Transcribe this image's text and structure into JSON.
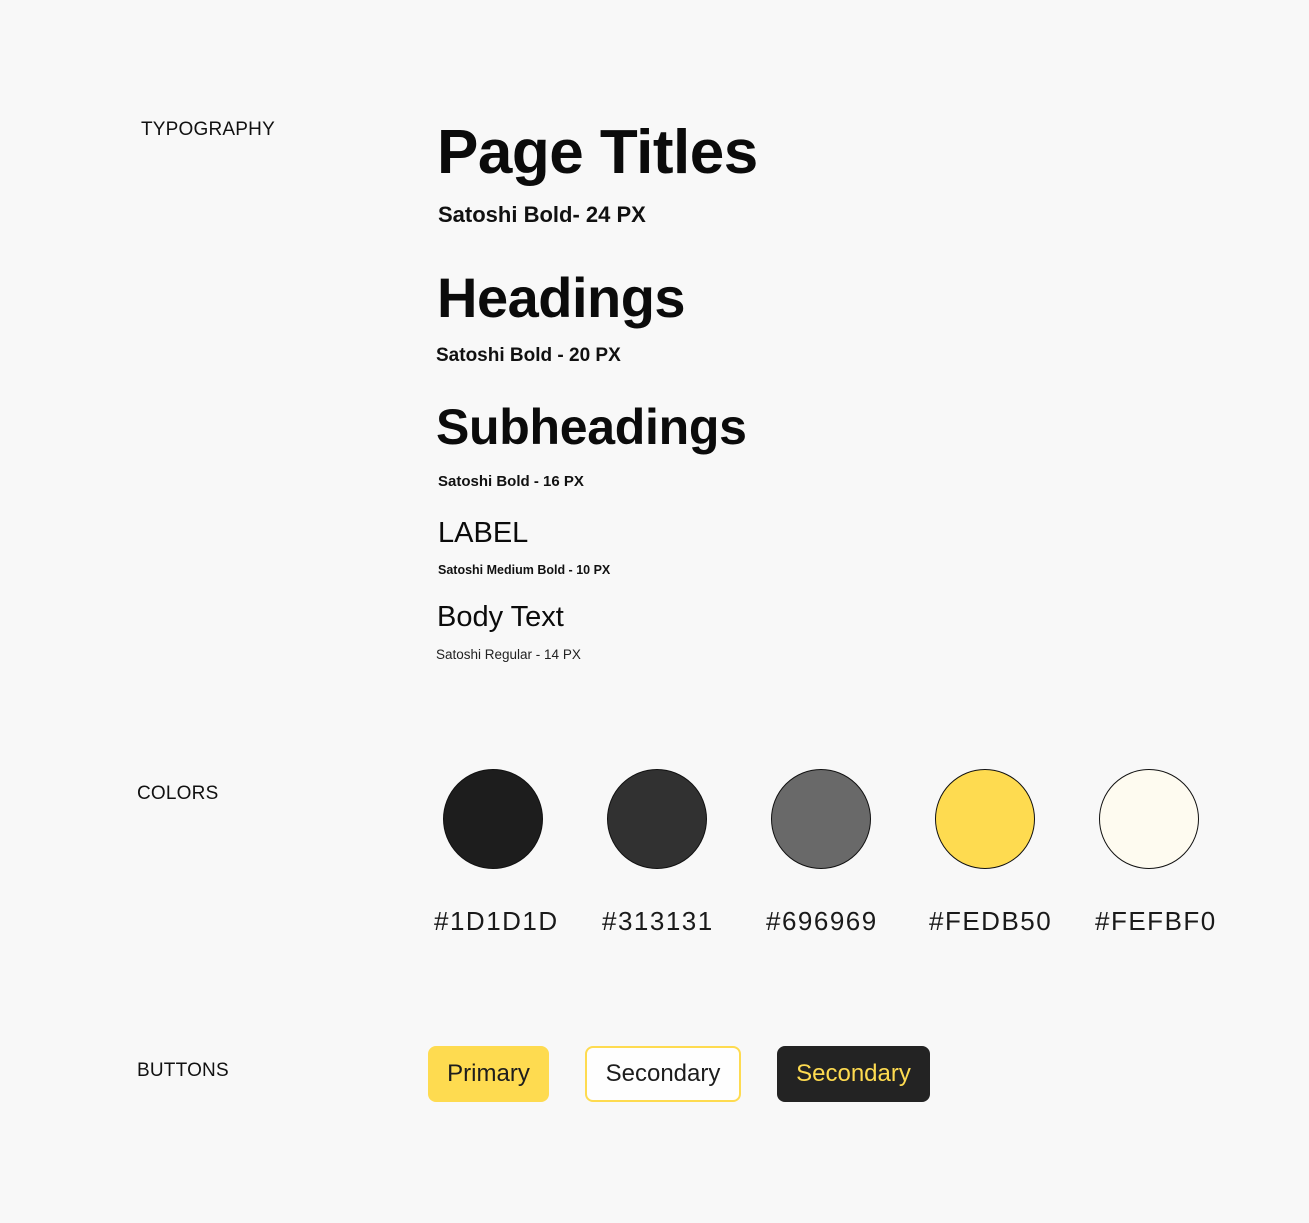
{
  "sections": {
    "typography": "TYPOGRAPHY",
    "colors": "COLORS",
    "buttons": "BUTTONS"
  },
  "typography": {
    "page_title": {
      "sample": "Page Titles",
      "desc": "Satoshi Bold- 24 PX"
    },
    "headings": {
      "sample": "Headings",
      "desc": "Satoshi Bold - 20 PX"
    },
    "subheadings": {
      "sample": "Subheadings",
      "desc": "Satoshi Bold - 16 PX"
    },
    "label": {
      "sample": "LABEL",
      "desc": "Satoshi Medium Bold - 10 PX"
    },
    "body": {
      "sample": "Body Text",
      "desc": "Satoshi Regular - 14 PX"
    }
  },
  "colors": [
    {
      "hex": "#1D1D1D",
      "color": "#1D1D1D"
    },
    {
      "hex": "#313131",
      "color": "#313131"
    },
    {
      "hex": "#696969",
      "color": "#696969"
    },
    {
      "hex": "#FEDB50",
      "color": "#FEDB50"
    },
    {
      "hex": "#FEFBF0",
      "color": "#FEFBF0"
    }
  ],
  "buttons": {
    "primary": "Primary",
    "secondary_outline": "Secondary",
    "secondary_dark": "Secondary"
  }
}
